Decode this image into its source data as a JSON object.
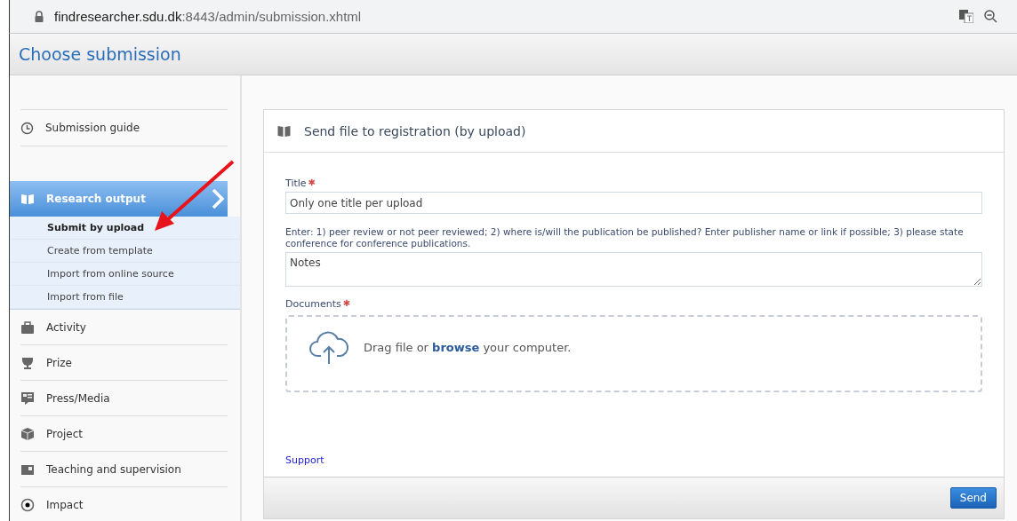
{
  "address_bar": {
    "host": "findresearcher.sdu.dk",
    "path": ":8443/admin/submission.xhtml"
  },
  "header": {
    "title": "Choose submission"
  },
  "sidebar": {
    "guide": {
      "label": "Submission guide"
    },
    "sections": [
      {
        "label": "Research output",
        "selected": true,
        "expanded": true,
        "children": [
          {
            "label": "Submit by upload",
            "selected": true
          },
          {
            "label": "Create from template",
            "selected": false
          },
          {
            "label": "Import from online source",
            "selected": false
          },
          {
            "label": "Import from file",
            "selected": false
          }
        ]
      },
      {
        "label": "Activity",
        "selected": false,
        "expanded": false
      },
      {
        "label": "Prize",
        "selected": false,
        "expanded": false
      },
      {
        "label": "Press/Media",
        "selected": false,
        "expanded": false
      },
      {
        "label": "Project",
        "selected": false,
        "expanded": false
      },
      {
        "label": "Teaching and supervision",
        "selected": false,
        "expanded": false
      },
      {
        "label": "Impact",
        "selected": false,
        "expanded": false
      }
    ]
  },
  "panel": {
    "title": "Send file to registration (by upload)",
    "title_field": {
      "label": "Title",
      "required_mark": "✱",
      "placeholder": "Only one title per upload"
    },
    "notes_help": "Enter: 1) peer review or not peer reviewed; 2) where is/will the publication be published? Enter publisher name or link if possible; 3) please state conference for conference publications.",
    "notes_field": {
      "placeholder": "Notes"
    },
    "documents": {
      "label": "Documents",
      "required_mark": "✱",
      "drop_text": "Drag file or **browse** your computer."
    },
    "support_link": "Support",
    "send_button": "Send"
  }
}
